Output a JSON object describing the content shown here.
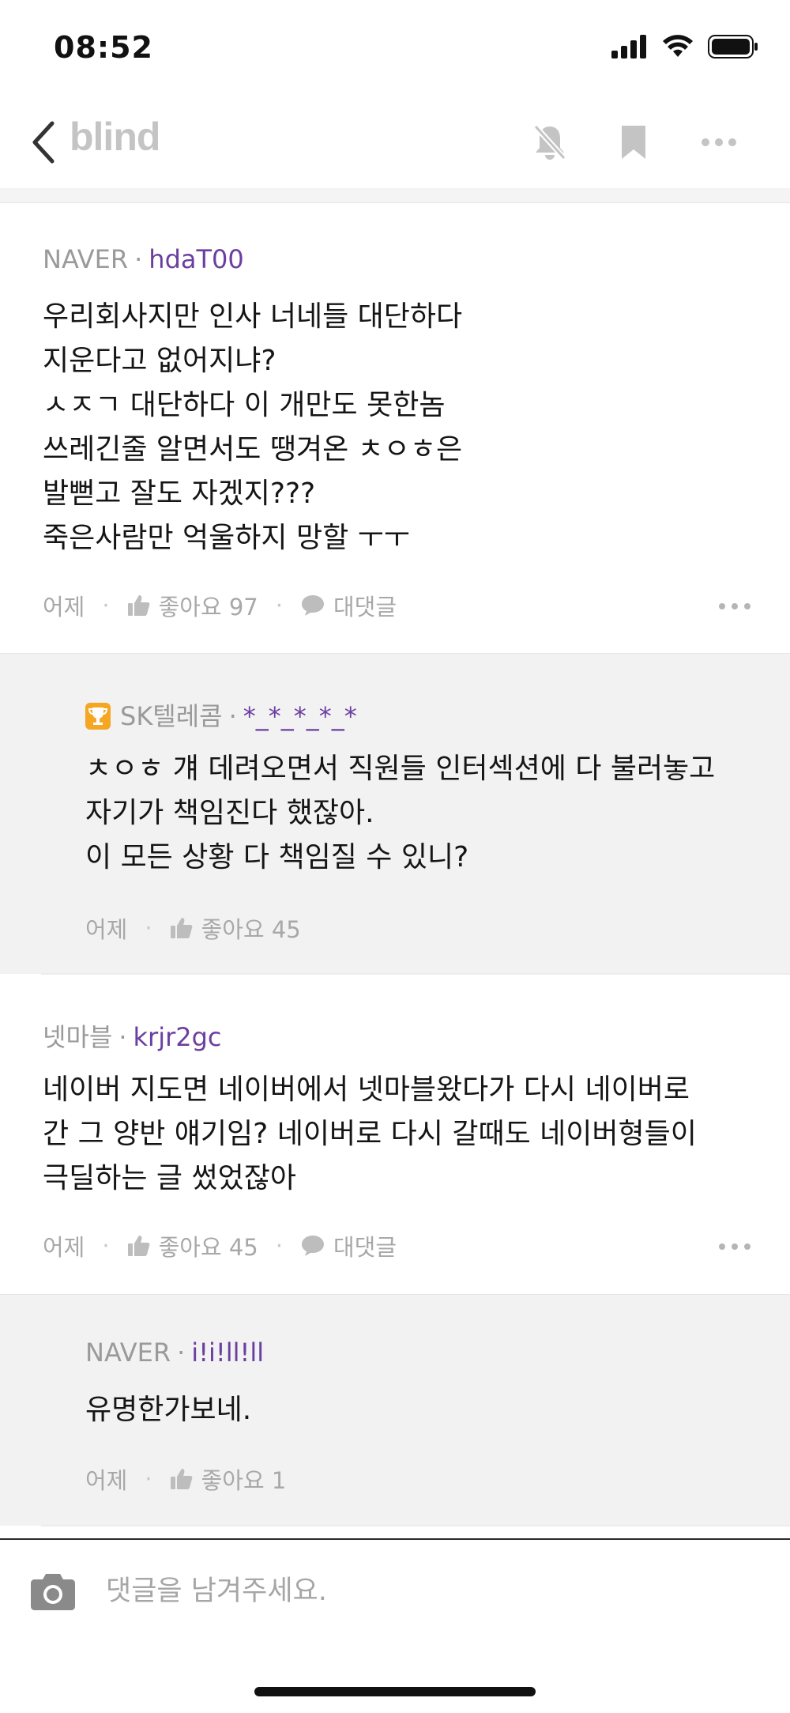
{
  "status": {
    "time": "08:52"
  },
  "nav": {
    "brand": "blind",
    "icons": [
      "back-chevron-icon",
      "bell-off-icon",
      "bookmark-icon",
      "more-icon"
    ]
  },
  "comments": [
    {
      "company": "NAVER",
      "nickname": "hdaT00",
      "text": "우리회사지만 인사 너네들 대단하다\n지운다고 없어지냐?\nㅅㅈㄱ 대단하다 이 개만도 못한놈\n쓰레긴줄 알면서도 땡겨온 ㅊㅇㅎ은\n발뻗고 잘도 자겠지???\n죽은사람만 억울하지 망할 ㅜㅜ",
      "time": "어제",
      "likes": "좋아요 97",
      "reply": "대댓글"
    },
    {
      "company": "SK텔레콤",
      "nickname": "*_*_*_*_*",
      "badge": "trophy-icon",
      "text": "ㅊㅇㅎ 걔 데려오면서 직원들 인터섹션에 다 불러놓고\n자기가 책임진다 했잖아.\n이 모든 상황 다 책임질 수 있니?",
      "time": "어제",
      "likes": "좋아요 45"
    },
    {
      "company": "넷마블",
      "nickname": "krjr2gc",
      "text": "네이버 지도면 네이버에서 넷마블왔다가 다시 네이버로\n간 그 양반 얘기임? 네이버로 다시 갈때도 네이버형들이\n극딜하는 글 썼었잖아",
      "time": "어제",
      "likes": "좋아요 45",
      "reply": "대댓글"
    },
    {
      "company": "NAVER",
      "nickname": "i!i!ll!ll",
      "text": "유명한가보네.",
      "time": "어제",
      "likes": "좋아요 1"
    }
  ],
  "input": {
    "placeholder": "댓글을 남겨주세요."
  },
  "colors": {
    "nickname": "#6b3fa0",
    "reply_bg": "#f2f2f3",
    "muted": "#9a9a9a"
  }
}
